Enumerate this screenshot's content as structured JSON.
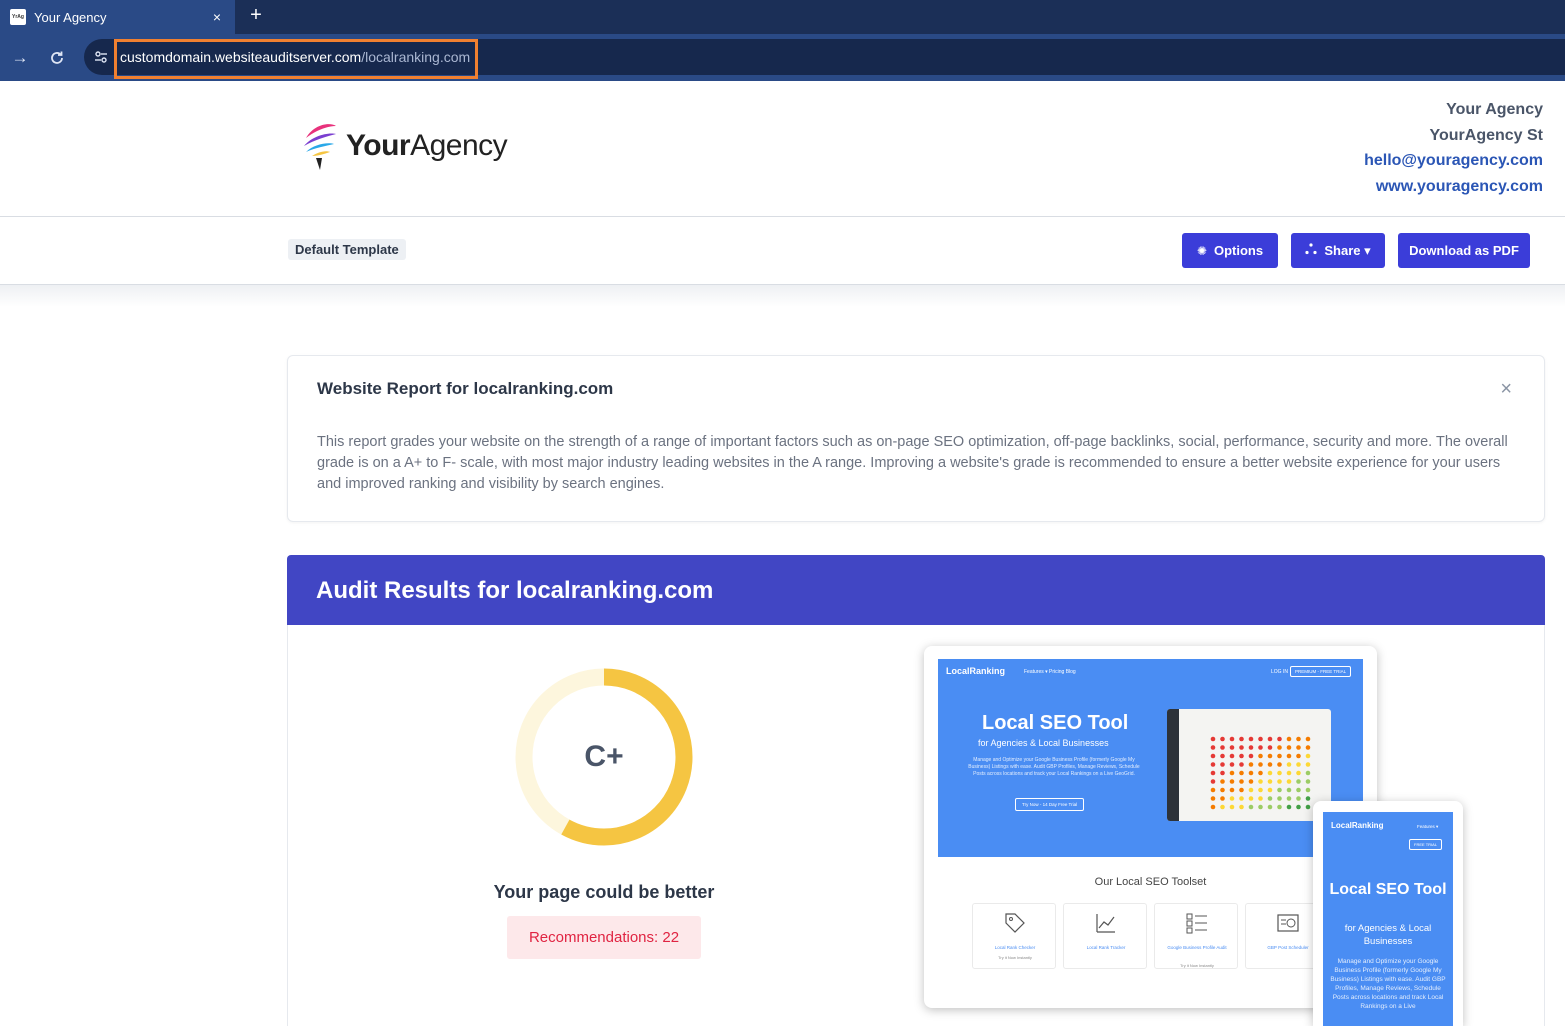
{
  "browser": {
    "tab_title": "Your Agency",
    "tab_close": "×",
    "new_tab": "+",
    "url_domain": "customdomain.websiteauditserver.com",
    "url_path": "/localranking.com"
  },
  "header": {
    "logo_bold": "Your",
    "logo_regular": "Agency",
    "contact_name": "Your Agency",
    "contact_street": "YourAgency St",
    "contact_email": "hello@youragency.com",
    "contact_website": "www.youragency.com"
  },
  "toolbar": {
    "template_label": "Default Template",
    "options_label": "Options",
    "share_label": "Share ▾",
    "download_label": "Download as PDF"
  },
  "report": {
    "title": "Website Report for localranking.com",
    "close": "×",
    "description": "This report grades your website on the strength of a range of important factors such as on-page SEO optimization, off-page backlinks, social, performance, security and more. The overall grade is on a A+ to F- scale, with most major industry leading websites in the A range. Improving a website's grade is recommended to ensure a better website experience for your users and improved ranking and visibility by search engines."
  },
  "audit": {
    "title": "Audit Results for localranking.com",
    "grade": "C+",
    "grade_fraction": 0.58,
    "caption": "Your page could be better",
    "recommendations": "Recommendations: 22"
  },
  "preview": {
    "desktop": {
      "logo": "LocalRanking",
      "nav": "Features ▾    Pricing    Blog",
      "login": "LOG IN",
      "trial": "PREMIUM - FREE TRIAL",
      "headline": "Local SEO Tool",
      "subheadline": "for Agencies & Local Businesses",
      "paragraph": "Manage and Optimize your Google Business Profile (formerly Google My Business) Listings with ease. Audit GBP Profiles, Manage Reviews, Schedule Posts across locations and track your Local Rankings on a Live GeoGrid.",
      "cta": "Try Now - 14 Day Free Trial",
      "toolset_title": "Our Local SEO Toolset",
      "tools": [
        {
          "label": "Local Rank Checker",
          "sub": "Try it Now Instantly"
        },
        {
          "label": "Local Rank Tracker",
          "sub": ""
        },
        {
          "label": "Google Business Profile Audit",
          "sub": "Try it Now Instantly"
        },
        {
          "label": "GBP Post Scheduler",
          "sub": ""
        }
      ]
    },
    "mobile": {
      "logo": "LocalRanking",
      "nav": "Features ▾",
      "trial": "FREE TRIAL",
      "headline": "Local SEO Tool",
      "subheadline": "for Agencies & Local Businesses",
      "paragraph": "Manage and Optimize your Google Business Profile (formerly Google My Business) Listings with ease. Audit GBP Profiles, Manage Reviews, Schedule Posts across locations and track Local Rankings on a Live"
    }
  },
  "colors": {
    "accent": "#3b3dd9",
    "audit_header": "#4146c4",
    "grade_ring": "#f5c542",
    "grade_track": "#fdf6dd",
    "reco_text": "#e02442",
    "url_highlight": "#f08030"
  }
}
